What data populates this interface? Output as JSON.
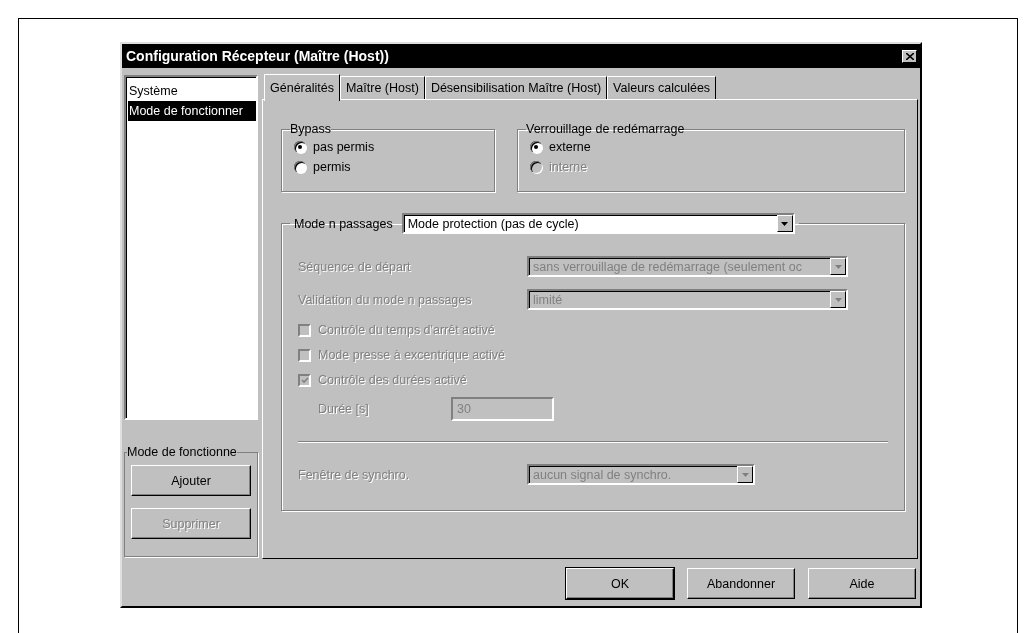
{
  "window": {
    "title": "Configuration Récepteur (Maître (Host))"
  },
  "sidebar": {
    "items": [
      {
        "label": "Système",
        "selected": false
      },
      {
        "label": "Mode de fonctionner",
        "selected": true
      }
    ],
    "group_title": "Mode de fonctionne",
    "buttons": [
      {
        "label": "Ajouter",
        "disabled": false
      },
      {
        "label": "Supprimer",
        "disabled": true
      }
    ]
  },
  "tabs": [
    {
      "label": "Généralités",
      "selected": true
    },
    {
      "label": "Maître (Host)",
      "selected": false
    },
    {
      "label": "Désensibilisation Maître (Host)",
      "selected": false
    },
    {
      "label": "Valeurs calculées",
      "selected": false
    }
  ],
  "groups": [
    {
      "title": "Bypass",
      "options": [
        {
          "label": "pas permis",
          "selected": true,
          "disabled": false
        },
        {
          "label": "permis",
          "selected": false,
          "disabled": false
        }
      ]
    },
    {
      "title": "Verrouillage de redémarrage",
      "options": [
        {
          "label": "externe",
          "selected": true,
          "disabled": false
        },
        {
          "label": "interne",
          "selected": false,
          "disabled": true
        }
      ]
    }
  ],
  "n_pass": {
    "label": "Mode n passages",
    "value": "Mode protection (pas de cycle)",
    "disabled": false,
    "rows": [
      {
        "kind": "select",
        "label": "Séquence de départ",
        "value": "sans verrouillage de redémarrage (seulement oc",
        "disabled": true
      },
      {
        "kind": "select",
        "label": "Validation du mode n passages",
        "value": "limité",
        "disabled": true
      },
      {
        "kind": "checkbox",
        "label": "Contrôle du temps d'arrêt activé",
        "checked": false,
        "disabled": true
      },
      {
        "kind": "checkbox",
        "label": "Mode presse à excentrique activé",
        "checked": false,
        "disabled": true
      },
      {
        "kind": "checkbox",
        "label": "Contrôle des durées activé",
        "checked": true,
        "disabled": true
      },
      {
        "kind": "input",
        "label": "Durée [s]",
        "value": "30",
        "disabled": true
      }
    ],
    "sync": {
      "label": "Fenêtre de synchro.",
      "value": "aucun signal de synchro.",
      "disabled": true
    }
  },
  "buttons": [
    {
      "label": "OK",
      "default": true
    },
    {
      "label": "Abandonner",
      "default": false
    },
    {
      "label": "Aide",
      "default": false
    }
  ]
}
